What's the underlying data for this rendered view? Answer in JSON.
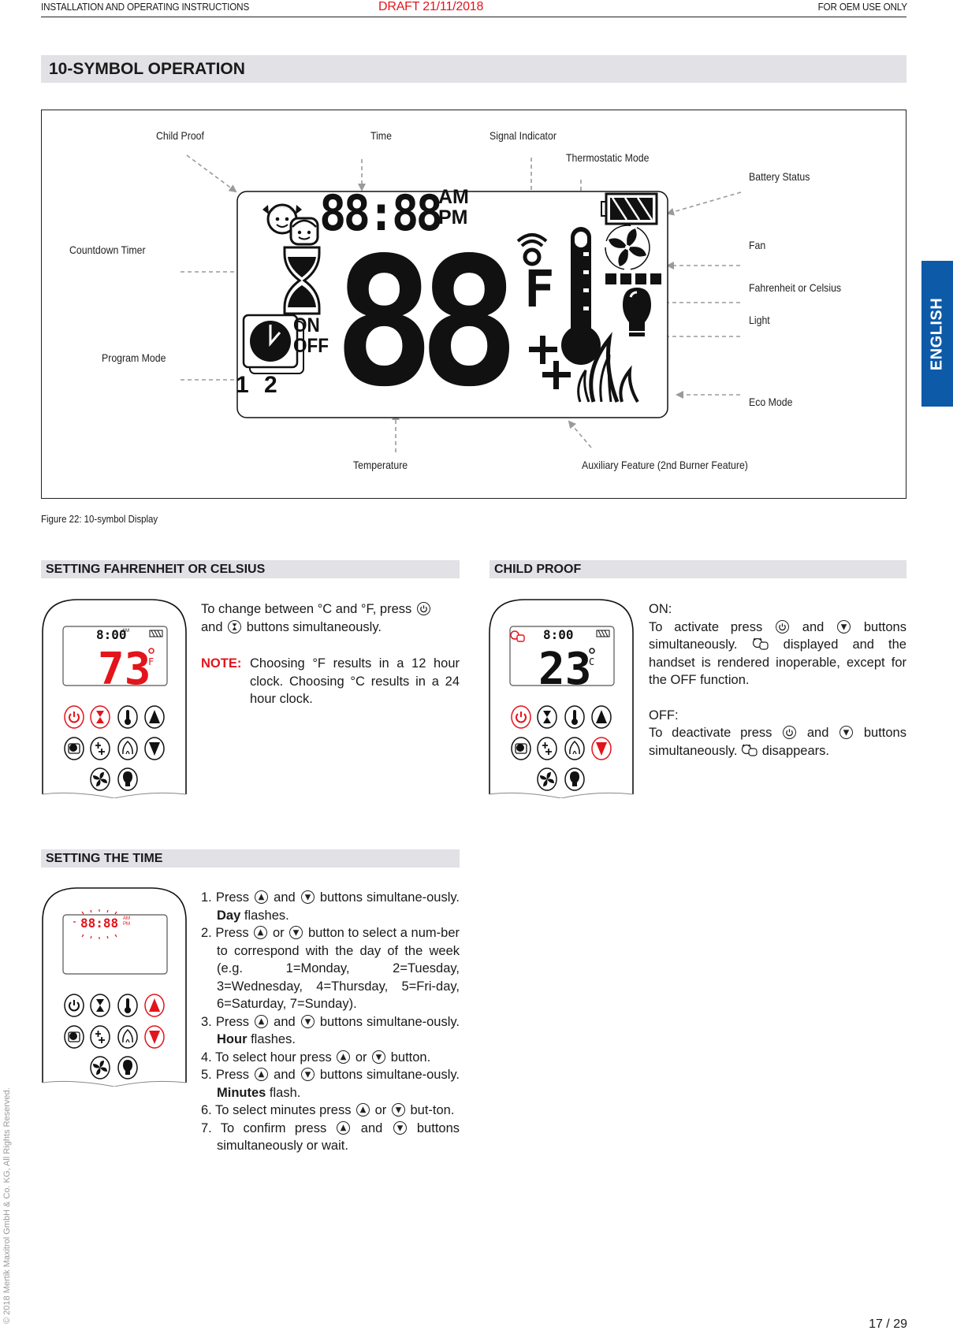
{
  "header": {
    "left": "INSTALLATION AND OPERATING INSTRUCTIONS",
    "center": "DRAFT 21/11/2018",
    "right": "FOR OEM USE ONLY"
  },
  "section_main": {
    "title": "10-SYMBOL OPERATION"
  },
  "figure": {
    "caption": "Figure 22: 10-symbol Display",
    "labels": {
      "child_proof": "Child Proof",
      "time": "Time",
      "signal_indicator": "Signal Indicator",
      "thermostatic_mode": "Thermostatic Mode",
      "battery_status": "Battery Status",
      "countdown_timer": "Countdown Timer",
      "fan": "Fan",
      "fahrenheit_celsius": "Fahrenheit or Celsius",
      "light": "Light",
      "program_mode": "Program Mode",
      "eco_mode": "Eco Mode",
      "temperature": "Temperature",
      "auxiliary_feature": "Auxiliary Feature (2nd Burner Feature)"
    },
    "lcd": {
      "time_digits": "88:88",
      "am": "AM",
      "pm": "PM",
      "temp_digits": "88",
      "unit": "F",
      "on": "ON",
      "off": "OFF",
      "program_1": "1",
      "program_2": "2"
    }
  },
  "fahrenheit_section": {
    "title": "SETTING FAHRENHEIT OR CELSIUS",
    "text_part1": "To change between °C and °F, press",
    "text_part2": "and",
    "text_part3": "buttons simultaneously.",
    "note_label": "NOTE:",
    "note_text": "Choosing °F results in a 12 hour clock. Choosing °C results in a 24 hour clock.",
    "remote": {
      "time": "8:00",
      "ampm": "AM",
      "temp": "73",
      "unit": "F",
      "highlight": [
        "power",
        "timer"
      ]
    }
  },
  "child_proof_section": {
    "title": "CHILD PROOF",
    "on_label": "ON:",
    "on_part1": "To activate press",
    "on_part2": "and",
    "on_part3": "buttons simultaneously.",
    "on_part4": "displayed and the handset is rendered inoperable, except for the OFF function.",
    "off_label": "OFF:",
    "off_part1": "To deactivate press",
    "off_part2": "and",
    "off_part3": "buttons simultaneously.",
    "off_part4": "disappears.",
    "remote": {
      "time": "8:00",
      "temp": "23",
      "unit": "C",
      "highlight": [
        "power",
        "down"
      ]
    }
  },
  "time_section": {
    "title": "SETTING THE TIME",
    "steps": [
      {
        "num": "1.",
        "a": "Press",
        "b": "and",
        "c": "buttons simultane-ously.",
        "bold": "Day",
        "d": "flashes."
      },
      {
        "num": "2.",
        "a": "Press",
        "b": "or",
        "c": "button to select a num-ber to correspond with the day of the week (e.g. 1=Monday, 2=Tuesday, 3=Wednesday, 4=Thursday, 5=Fri-day, 6=Saturday, 7=Sunday)."
      },
      {
        "num": "3.",
        "a": "Press",
        "b": "and",
        "c": "buttons simultane-ously.",
        "bold": "Hour",
        "d": "flashes."
      },
      {
        "num": "4.",
        "a": "To select hour press",
        "b": "or",
        "c": "button."
      },
      {
        "num": "5.",
        "a": "Press",
        "b": "and",
        "c": "buttons simultane-ously.",
        "bold": "Minutes",
        "d": "flash."
      },
      {
        "num": "6.",
        "a": "To select minutes press",
        "b": "or",
        "c": "but-ton."
      },
      {
        "num": "7.",
        "a": "To confirm press",
        "b": "and",
        "c": "buttons simultaneously or wait."
      }
    ],
    "remote": {
      "time": "88:88",
      "am": "AM",
      "pm": "PM",
      "highlight": [
        "up",
        "down"
      ]
    }
  },
  "side_tab": {
    "label": "ENGLISH"
  },
  "copyright": "© 2018 Mertik Maxitrol GmbH & Co. KG, All Rights Reserved.",
  "page_number": "17 / 29",
  "colors": {
    "accent_red": "#e3141b",
    "tab_blue": "#0d5aa8",
    "bar_gray": "#e1e1e6",
    "arrow_gray": "#9a9a9a"
  }
}
